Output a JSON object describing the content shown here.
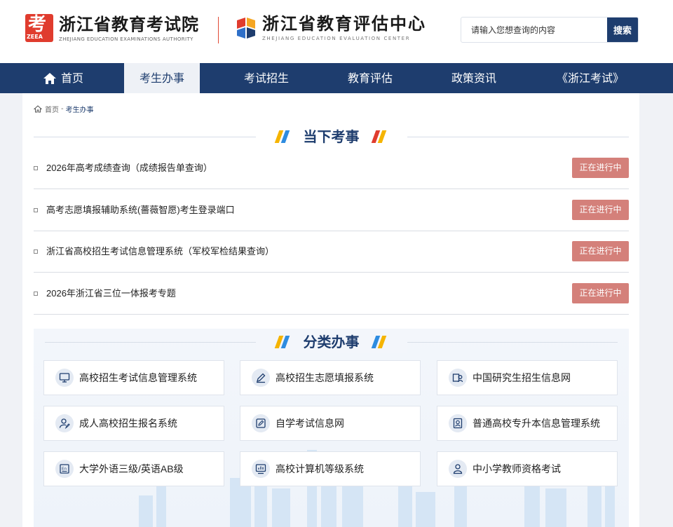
{
  "header": {
    "logo_exam": {
      "badge_char": "考",
      "badge_abbr": "ZEEA",
      "name": "浙江省教育考试院",
      "name_en": "ZHEJIANG EDUCATION EXAMINATIONS AUTHORITY"
    },
    "logo_eval": {
      "name": "浙江省教育评估中心",
      "name_en": "ZHEJIANG EDUCATION EVALUATION CENTER"
    },
    "search": {
      "placeholder": "请输入您想查询的内容",
      "button_label": "搜索"
    }
  },
  "nav": {
    "items": [
      {
        "label": "首页"
      },
      {
        "label": "考生办事",
        "active": true
      },
      {
        "label": "考试招生"
      },
      {
        "label": "教育评估"
      },
      {
        "label": "政策资讯"
      },
      {
        "label": "《浙江考试》"
      }
    ]
  },
  "breadcrumb": {
    "home": "首页",
    "separator": "-",
    "current": "考生办事"
  },
  "current_tasks": {
    "title": "当下考事",
    "items": [
      {
        "label": "2026年高考成绩查询（成绩报告单查询）",
        "status": "正在进行中"
      },
      {
        "label": "高考志愿填报辅助系统(薔薇智愿)考生登录端口",
        "status": "正在进行中"
      },
      {
        "label": "浙江省高校招生考试信息管理系统（军校军检结果查询）",
        "status": "正在进行中"
      },
      {
        "label": "2026年浙江省三位一体报考专题",
        "status": "正在进行中"
      }
    ]
  },
  "categories": {
    "title": "分类办事",
    "items": [
      {
        "label": "高校招生考试信息管理系统",
        "icon": "monitor-icon"
      },
      {
        "label": "高校招生志愿填报系统",
        "icon": "pencil-icon"
      },
      {
        "label": "中国研究生招生信息网",
        "icon": "graduate-icon"
      },
      {
        "label": "成人高校招生报名系统",
        "icon": "user-edit-icon"
      },
      {
        "label": "自学考试信息网",
        "icon": "edit-box-icon"
      },
      {
        "label": "普通高校专升本信息管理系统",
        "icon": "id-card-icon"
      },
      {
        "label": "大学外语三级/英语AB级",
        "icon": "english-icon"
      },
      {
        "label": "高校计算机等级系统",
        "icon": "chart-monitor-icon"
      },
      {
        "label": "中小学教师资格考试",
        "icon": "teacher-icon"
      }
    ]
  },
  "colors": {
    "primary": "#1e3d6e",
    "badge": "#d4807a",
    "logo_red": "#e03c2e",
    "accent_yellow": "#f5b400",
    "accent_blue": "#2e8ce0",
    "accent_red": "#e03c2e"
  }
}
